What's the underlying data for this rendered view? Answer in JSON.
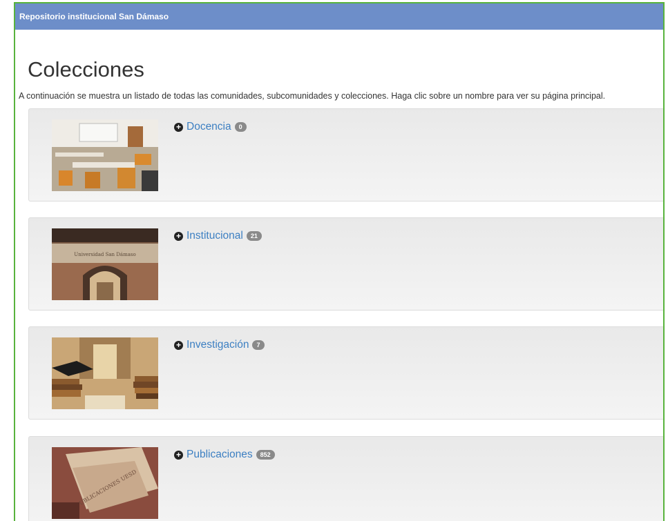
{
  "header": {
    "title": "Repositorio institucional San Dámaso"
  },
  "page": {
    "title": "Colecciones",
    "intro": "A continuación se muestra un listado de todas las comunidades, subcomunidades y colecciones. Haga clic sobre un nombre para ver su página principal."
  },
  "collections": [
    {
      "name": "Docencia",
      "count": "0",
      "image": "classroom-image"
    },
    {
      "name": "Institucional",
      "count": "21",
      "image": "university-entrance-image",
      "image_text": "Universidad San Dámaso"
    },
    {
      "name": "Investigación",
      "count": "7",
      "image": "books-graduation-image"
    },
    {
      "name": "Publicaciones",
      "count": "852",
      "image": "publications-image",
      "image_text": "PUBLICACIONES UESD"
    }
  ],
  "colors": {
    "header_bg": "#6d8ec9",
    "frame_border": "#58b33c",
    "link": "#3c7fc2",
    "badge": "#8a8a8a"
  }
}
